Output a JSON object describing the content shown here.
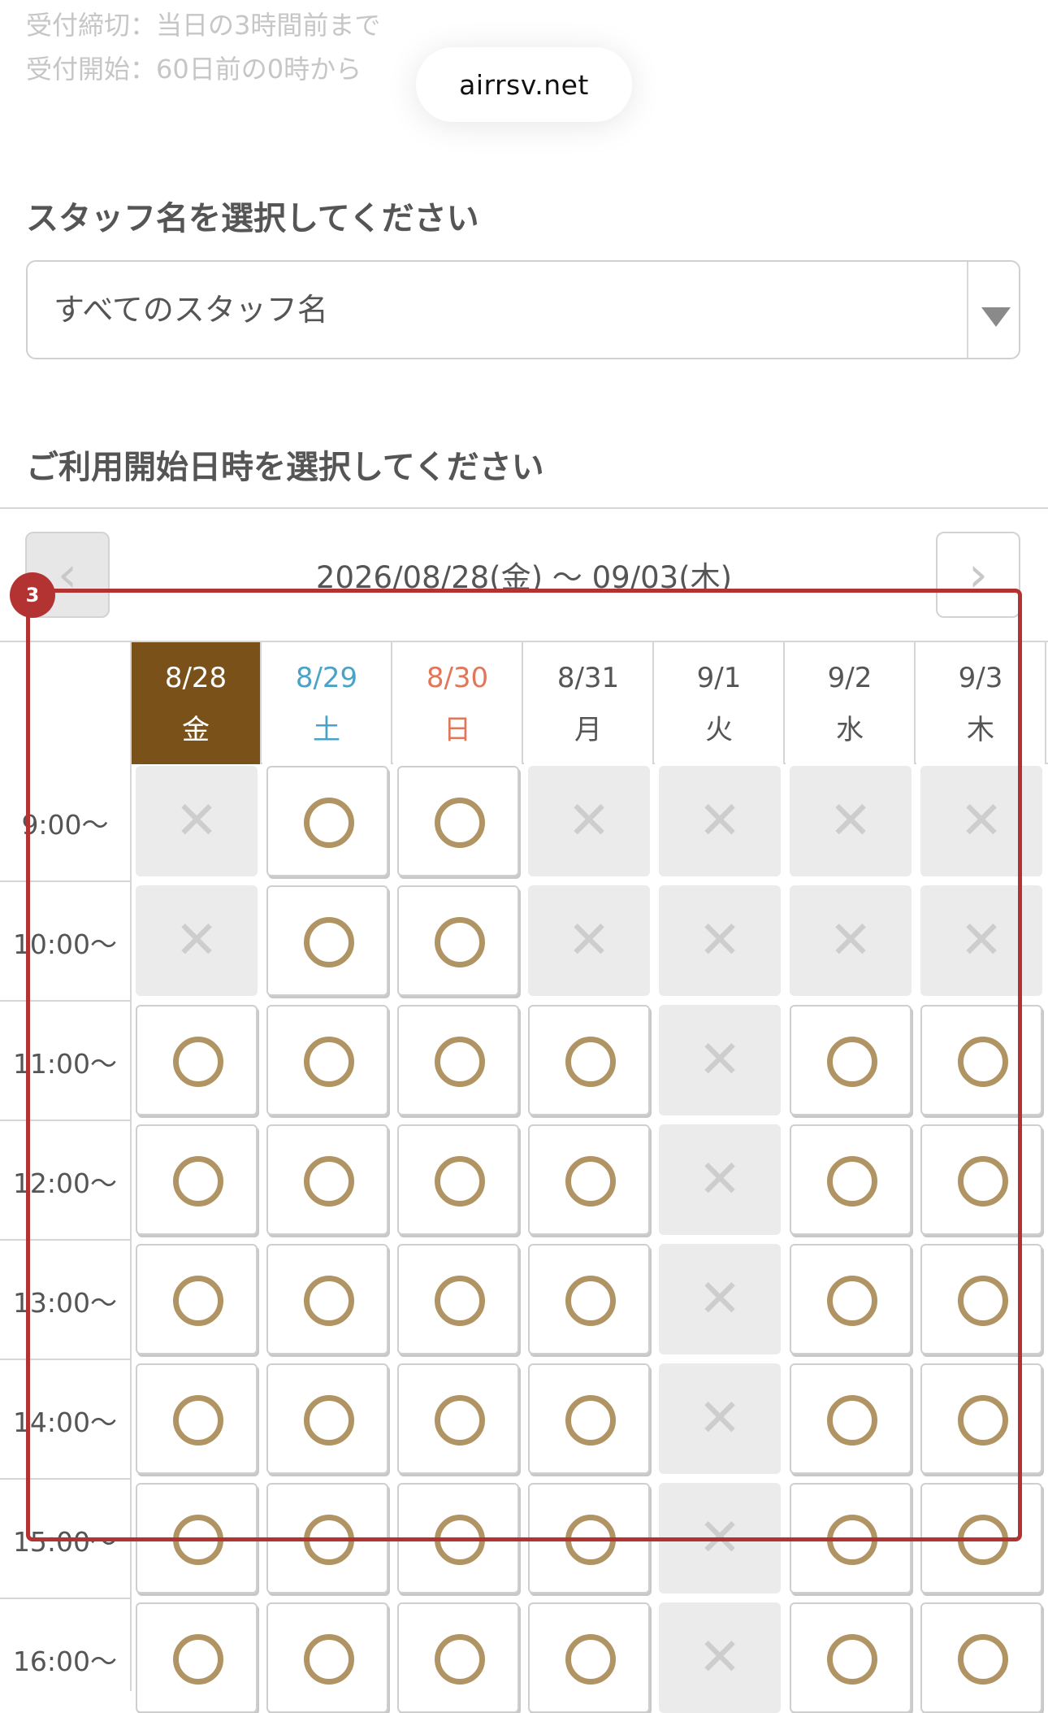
{
  "info": {
    "deadline": "受付締切：当日の3時間前まで",
    "opening": "受付開始：60日前の0時から"
  },
  "url_pill": "airrsv.net",
  "staff": {
    "title": "スタッフ名を選択してください",
    "selected": "すべてのスタッフ名"
  },
  "date_section": {
    "title": "ご利用開始日時を選択してください",
    "range": "2026/08/28(金) 〜 09/03(木)",
    "prev_glyph": "‹",
    "next_glyph": "›"
  },
  "days": [
    {
      "date": "8/28",
      "weekday": "金",
      "selected": true
    },
    {
      "date": "8/29",
      "weekday": "土"
    },
    {
      "date": "8/30",
      "weekday": "日"
    },
    {
      "date": "8/31",
      "weekday": "月"
    },
    {
      "date": "9/1",
      "weekday": "火"
    },
    {
      "date": "9/2",
      "weekday": "水"
    },
    {
      "date": "9/3",
      "weekday": "木"
    }
  ],
  "times": [
    "9:00〜",
    "10:00〜",
    "11:00〜",
    "12:00〜",
    "13:00〜",
    "14:00〜",
    "15:00〜",
    "16:00〜"
  ],
  "availability": [
    [
      "x",
      "o",
      "o",
      "x",
      "x",
      "x",
      "x"
    ],
    [
      "x",
      "o",
      "o",
      "x",
      "x",
      "x",
      "x"
    ],
    [
      "o",
      "o",
      "o",
      "o",
      "x",
      "o",
      "o"
    ],
    [
      "o",
      "o",
      "o",
      "o",
      "x",
      "o",
      "o"
    ],
    [
      "o",
      "o",
      "o",
      "o",
      "x",
      "o",
      "o"
    ],
    [
      "o",
      "o",
      "o",
      "o",
      "x",
      "o",
      "o"
    ],
    [
      "o",
      "o",
      "o",
      "o",
      "x",
      "o",
      "o"
    ],
    [
      "o",
      "o",
      "o",
      "o",
      "x",
      "o",
      "o"
    ]
  ],
  "colors": {
    "selected_day_bg": "#7a5118",
    "saturday": "#4aa3c6",
    "sunday": "#e0765a",
    "available_circle": "#b09463",
    "highlight": "#b33232"
  },
  "highlight": {
    "badge": "3"
  },
  "icons": {
    "prev": "chevron-left-icon",
    "next": "chevron-right-icon",
    "select": "triangle-down-icon"
  }
}
